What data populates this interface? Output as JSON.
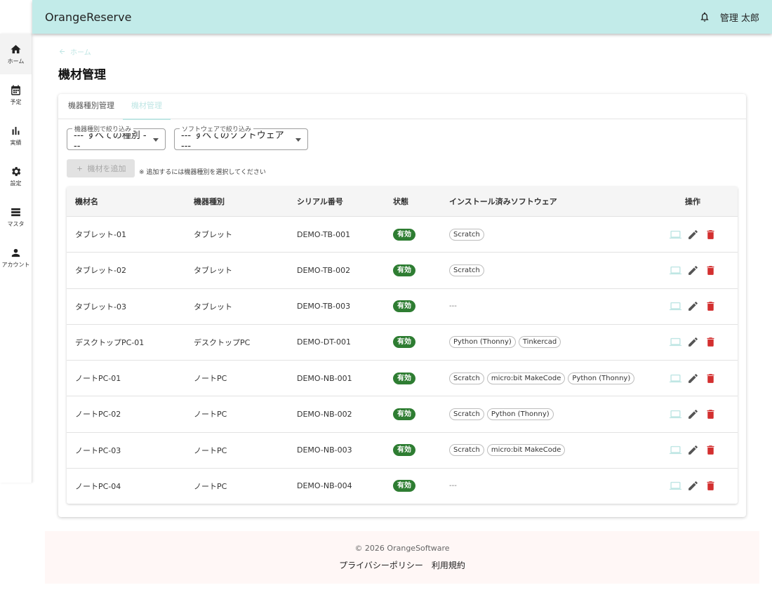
{
  "app": {
    "title": "OrangeReserve",
    "user": "管理 太郎"
  },
  "sidebar": {
    "items": [
      {
        "label": "ホーム",
        "icon": "home-icon"
      },
      {
        "label": "予定",
        "icon": "calendar-icon"
      },
      {
        "label": "実績",
        "icon": "bar-chart-icon"
      },
      {
        "label": "設定",
        "icon": "gear-icon"
      },
      {
        "label": "マスタ",
        "icon": "list-icon"
      },
      {
        "label": "アカウント",
        "icon": "person-icon"
      }
    ]
  },
  "breadcrumb": {
    "home": "ホーム"
  },
  "page": {
    "title": "機材管理"
  },
  "tabs": [
    {
      "label": "機器種別管理"
    },
    {
      "label": "機材管理"
    }
  ],
  "filters": {
    "type": {
      "legend": "機器種別で絞り込み",
      "value": "--- すべての種別 ---"
    },
    "software": {
      "legend": "ソフトウェアで絞り込み",
      "value": "--- すべてのソフトウェア ---"
    }
  },
  "add": {
    "label": "機材を追加",
    "note": "※ 追加するには機器種別を選択してください"
  },
  "table": {
    "headers": [
      "機材名",
      "機器種別",
      "シリアル番号",
      "状態",
      "インストール済みソフトウェア",
      "操作"
    ],
    "rows": [
      {
        "name": "タブレット-01",
        "type": "タブレット",
        "serial": "DEMO-TB-001",
        "status": "有効",
        "software": [
          "Scratch"
        ]
      },
      {
        "name": "タブレット-02",
        "type": "タブレット",
        "serial": "DEMO-TB-002",
        "status": "有効",
        "software": [
          "Scratch"
        ]
      },
      {
        "name": "タブレット-03",
        "type": "タブレット",
        "serial": "DEMO-TB-003",
        "status": "有効",
        "software": []
      },
      {
        "name": "デスクトップPC-01",
        "type": "デスクトップPC",
        "serial": "DEMO-DT-001",
        "status": "有効",
        "software": [
          "Python (Thonny)",
          "Tinkercad"
        ]
      },
      {
        "name": "ノートPC-01",
        "type": "ノートPC",
        "serial": "DEMO-NB-001",
        "status": "有効",
        "software": [
          "Scratch",
          "micro:bit MakeCode",
          "Python (Thonny)"
        ]
      },
      {
        "name": "ノートPC-02",
        "type": "ノートPC",
        "serial": "DEMO-NB-002",
        "status": "有効",
        "software": [
          "Scratch",
          "Python (Thonny)"
        ]
      },
      {
        "name": "ノートPC-03",
        "type": "ノートPC",
        "serial": "DEMO-NB-003",
        "status": "有効",
        "software": [
          "Scratch",
          "micro:bit MakeCode"
        ]
      },
      {
        "name": "ノートPC-04",
        "type": "ノートPC",
        "serial": "DEMO-NB-004",
        "status": "有効",
        "software": []
      }
    ],
    "empty_software": "---"
  },
  "footer": {
    "copyright": "© 2026 OrangeSoftware",
    "privacy": "プライバシーポリシー",
    "terms": "利用規約"
  },
  "colors": {
    "appbar": "#c2ebe9",
    "accent": "#bfe6e4",
    "status": "#2e7d32",
    "delete": "#d32f2f",
    "footer_bg": "#fff7f6"
  }
}
